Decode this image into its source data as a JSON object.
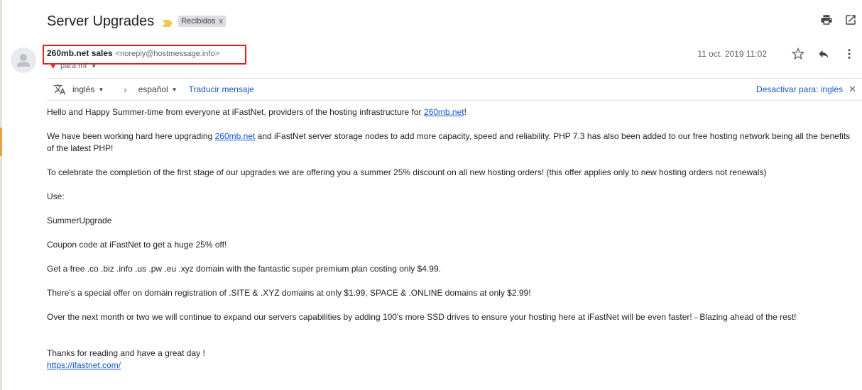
{
  "subject": "Server Upgrades",
  "label": {
    "name": "Recibidos",
    "close": "x"
  },
  "sender": {
    "name": "260mb.net sales",
    "email": "<noreply@hostmessage.info>"
  },
  "to": "para mí",
  "date": "11 oct. 2019 11:02",
  "translate": {
    "source_lang": "inglés",
    "target_lang": "español",
    "translate_link": "Traducir mensaje",
    "disable_link": "Desactivar para: inglés"
  },
  "body": {
    "p1_pre": "Hello and Happy Summer-time from everyone at iFastNet, providers of the hosting infrastructure for ",
    "p1_link": "260mb.net",
    "p1_post": "!",
    "p2_pre": "We have been working hard here upgrading ",
    "p2_link": "260mb.net",
    "p2_post": " and iFastNet server storage nodes to add more capacity, speed and reliability.  PHP 7.3 has also been added to our free hosting network being all the benefits of the latest PHP!",
    "p3": "To celebrate the completion of the first stage of our upgrades we are offering you a summer 25% discount on all new hosting orders!  (this offer applies only to new hosting orders not renewals)",
    "p4": "Use:",
    "p5": "SummerUpgrade",
    "p6": "Coupon code at iFastNet to get a huge 25% off!",
    "p7": "Get a free .co .biz .info .us .pw .eu .xyz domain with the fantastic super premium plan costing only $4.99.",
    "p8": "There's a special offer on domain registration of .SITE & .XYZ domains at only $1.99, SPACE & .ONLINE domains at only $2.99!",
    "p9": "Over the next month or two we will continue to expand our servers capabilities by adding 100's more SSD drives to ensure your hosting here at iFastNet will be even faster! - Blazing ahead of the rest!",
    "p10": "Thanks for reading and have a great day !",
    "p10_link": "https://ifastnet.com/"
  },
  "icons": {
    "print": "print-icon",
    "open_new_window": "open-in-new-window-icon",
    "star": "star-icon",
    "reply": "reply-icon",
    "more": "more-vert-icon",
    "translate": "translate-icon",
    "importance": "importance-marker-icon"
  },
  "colors": {
    "highlight_box": "#e02020",
    "link": "#1155cc",
    "importance": "#f2c94c"
  }
}
